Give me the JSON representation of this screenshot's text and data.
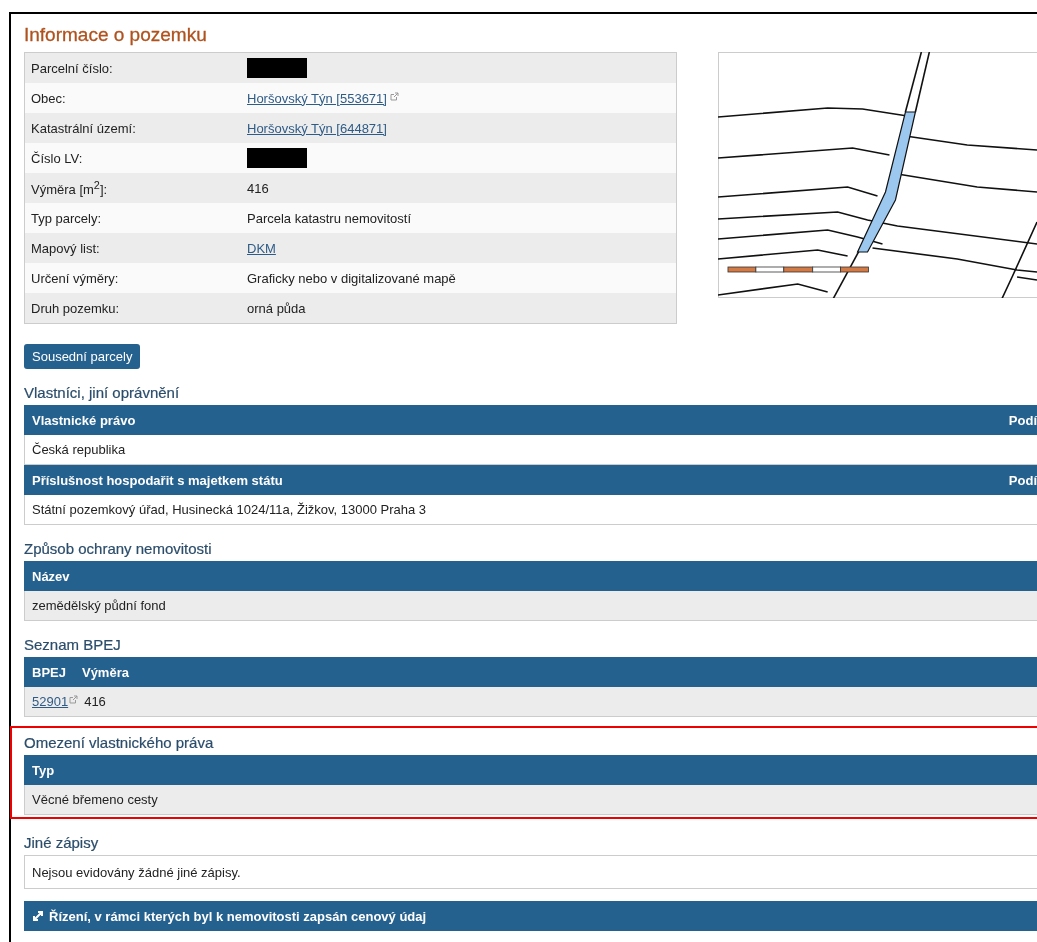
{
  "title": "Informace o pozemku",
  "info": [
    {
      "label": "Parcelní číslo:",
      "kind": "redacted"
    },
    {
      "label": "Obec:",
      "kind": "link",
      "value": "Horšovský Týn [553671]",
      "external": true
    },
    {
      "label": "Katastrální území:",
      "kind": "link",
      "value": "Horšovský Týn [644871]",
      "external": false
    },
    {
      "label": "Číslo LV:",
      "kind": "redacted"
    },
    {
      "label": "Výměra [m$^{2}$]:",
      "kind": "text",
      "value": "416"
    },
    {
      "label": "Typ parcely:",
      "kind": "text",
      "value": "Parcela katastru nemovitostí"
    },
    {
      "label": "Mapový list:",
      "kind": "link",
      "value": "DKM",
      "external": false
    },
    {
      "label": "Určení výměry:",
      "kind": "text",
      "value": "Graficky nebo v digitalizované mapě"
    },
    {
      "label": "Druh pozemku:",
      "kind": "text",
      "value": "orná půda"
    }
  ],
  "neighbors_button": "Sousední parcely",
  "sections": [
    {
      "heading": "Vlastníci, jiní oprávnění",
      "highlighted": false,
      "rows": [
        {
          "kind": "header",
          "columns": [
            "Vlastnické právo"
          ],
          "side": "Podí"
        },
        {
          "kind": "row",
          "shaded": false,
          "cells": [
            {
              "text": "Česká republika"
            }
          ]
        },
        {
          "kind": "header",
          "columns": [
            "Příslušnost hospodařit s majetkem státu"
          ],
          "side": "Podí"
        },
        {
          "kind": "row",
          "shaded": false,
          "cells": [
            {
              "text": "Státní pozemkový úřad, Husinecká 1024/11a, Žižkov, 13000 Praha 3"
            }
          ]
        }
      ]
    },
    {
      "heading": "Způsob ochrany nemovitosti",
      "highlighted": false,
      "rows": [
        {
          "kind": "header",
          "columns": [
            "Název"
          ]
        },
        {
          "kind": "row",
          "shaded": true,
          "cells": [
            {
              "text": "zemědělský půdní fond"
            }
          ]
        }
      ]
    },
    {
      "heading": "Seznam BPEJ",
      "highlighted": false,
      "rows": [
        {
          "kind": "header",
          "columns": [
            "BPEJ",
            "Výměra"
          ]
        },
        {
          "kind": "row",
          "shaded": true,
          "cells": [
            {
              "text": "52901",
              "link": true,
              "external": true
            },
            {
              "text": "416"
            }
          ]
        }
      ]
    },
    {
      "heading": "Omezení vlastnického práva",
      "highlighted": true,
      "rows": [
        {
          "kind": "header",
          "columns": [
            "Typ"
          ]
        },
        {
          "kind": "row",
          "shaded": true,
          "cells": [
            {
              "text": "Věcné břemeno cesty"
            }
          ]
        }
      ]
    },
    {
      "heading": "Jiné zápisy",
      "highlighted": false,
      "rows": [
        {
          "kind": "note",
          "text": "Nejsou evidovány žádné jiné zápisy."
        }
      ]
    }
  ],
  "price_bar": "Řízení, v rámci kterých byl k nemovitosti zapsán cenový údaj"
}
